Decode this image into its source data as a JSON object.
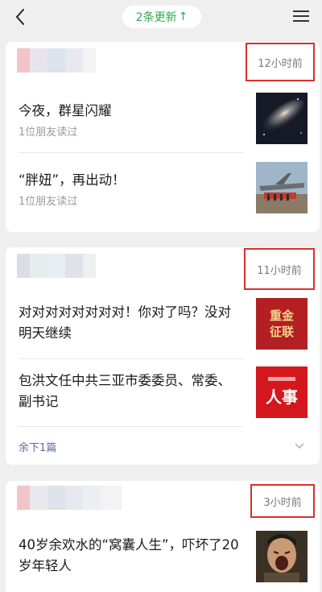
{
  "header": {
    "updates_label": "2条更新",
    "updates_arrow": "↑"
  },
  "cards": [
    {
      "time": "12小时前",
      "articles": [
        {
          "title": "今夜，群星闪耀",
          "sub": "1位朋友读过",
          "thumb": "galaxy-image"
        },
        {
          "title": "“胖妞”，再出动！",
          "sub": "1位朋友读过",
          "thumb": "aircraft-image"
        }
      ]
    },
    {
      "time": "11小时前",
      "articles": [
        {
          "title": "对对对对对对对对！你对了吗？没对明天继续",
          "thumb": "badge-zhongjin",
          "badge": "重金\n征联"
        },
        {
          "title": "包洪文任中共三亚市委委员、常委、副书记",
          "thumb": "badge-renshi",
          "badge": "人事"
        }
      ],
      "more": "余下1篇"
    },
    {
      "time": "3小时前",
      "articles": [
        {
          "title": "40岁余欢水的“窝囊人生”，吓坏了20岁年轻人",
          "thumb": "screaming-man-image"
        }
      ]
    }
  ],
  "colors": {
    "accent_green": "#2fa84f",
    "highlight_red": "#d9302c",
    "link_blue": "#5a6e97"
  }
}
